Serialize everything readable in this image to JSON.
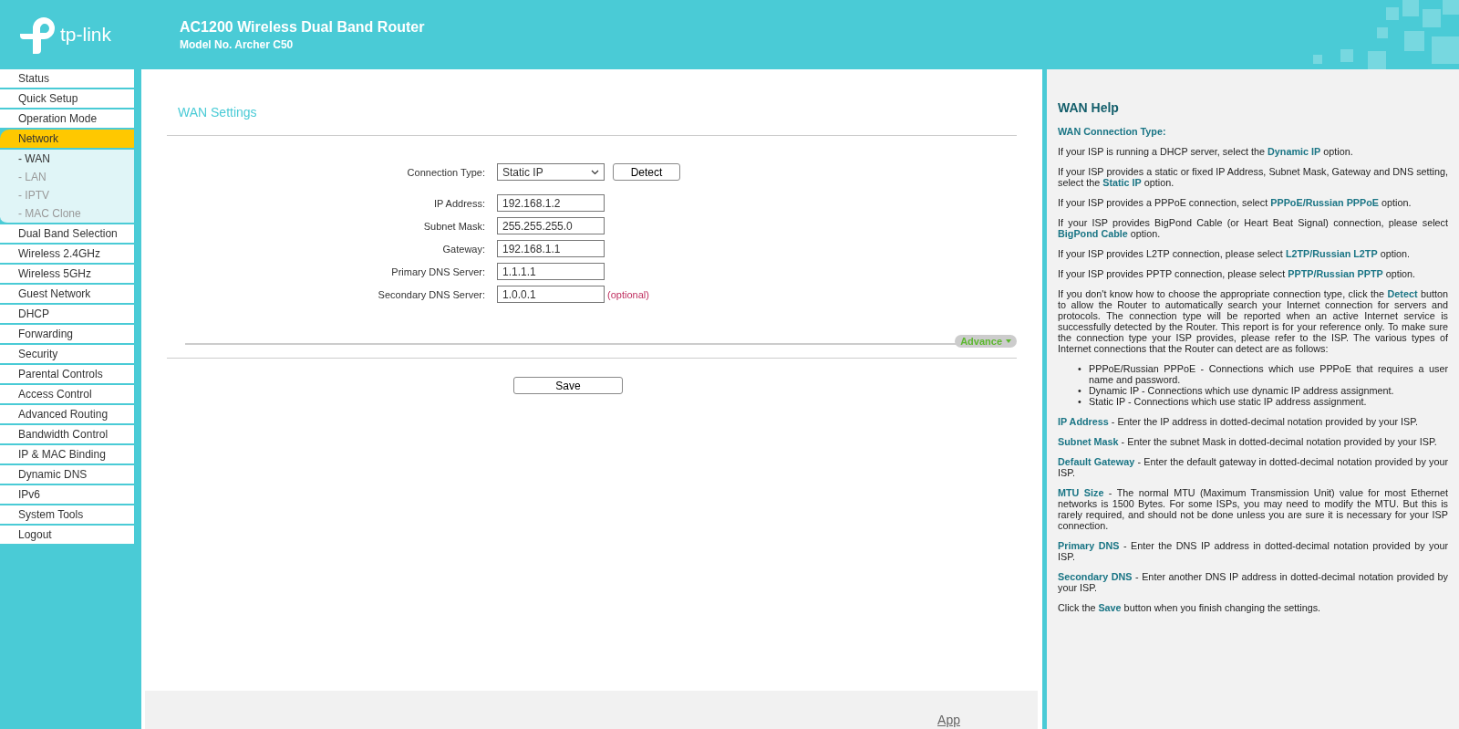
{
  "header": {
    "logo_text": "tp-link",
    "title": "AC1200 Wireless Dual Band Router",
    "model": "Model No. Archer C50"
  },
  "sidebar": {
    "items": [
      {
        "label": "Status",
        "selected": false
      },
      {
        "label": "Quick Setup",
        "selected": false
      },
      {
        "label": "Operation Mode",
        "selected": false
      },
      {
        "label": "Network",
        "selected": true,
        "expanded": true,
        "children": [
          {
            "label": "- WAN",
            "selected": true
          },
          {
            "label": "- LAN",
            "selected": false
          },
          {
            "label": "- IPTV",
            "selected": false
          },
          {
            "label": "- MAC Clone",
            "selected": false
          }
        ]
      },
      {
        "label": "Dual Band Selection",
        "selected": false
      },
      {
        "label": "Wireless 2.4GHz",
        "selected": false
      },
      {
        "label": "Wireless 5GHz",
        "selected": false
      },
      {
        "label": "Guest Network",
        "selected": false
      },
      {
        "label": "DHCP",
        "selected": false
      },
      {
        "label": "Forwarding",
        "selected": false
      },
      {
        "label": "Security",
        "selected": false
      },
      {
        "label": "Parental Controls",
        "selected": false
      },
      {
        "label": "Access Control",
        "selected": false
      },
      {
        "label": "Advanced Routing",
        "selected": false
      },
      {
        "label": "Bandwidth Control",
        "selected": false
      },
      {
        "label": "IP & MAC Binding",
        "selected": false
      },
      {
        "label": "Dynamic DNS",
        "selected": false
      },
      {
        "label": "IPv6",
        "selected": false
      },
      {
        "label": "System Tools",
        "selected": false
      },
      {
        "label": "Logout",
        "selected": false
      }
    ]
  },
  "main": {
    "title": "WAN Settings",
    "fields": [
      {
        "kind": "select",
        "label": "Connection Type:",
        "value": "Static IP",
        "button": "Detect"
      },
      {
        "kind": "input",
        "label": "IP Address:",
        "value": "192.168.1.2"
      },
      {
        "kind": "input",
        "label": "Subnet Mask:",
        "value": "255.255.255.0"
      },
      {
        "kind": "input",
        "label": "Gateway:",
        "value": "192.168.1.1"
      },
      {
        "kind": "input",
        "label": "Primary DNS Server:",
        "value": "1.1.1.1"
      },
      {
        "kind": "input",
        "label": "Secondary DNS Server:",
        "value": "1.0.0.1",
        "note": "(optional)"
      }
    ],
    "advance_button": "Advance",
    "save_button": "Save"
  },
  "help": {
    "title": "WAN Help",
    "subtitle": "WAN Connection Type:",
    "paragraphs_top": [
      "If your ISP is running a DHCP server, select the **Dynamic IP** option.",
      "If your ISP provides a static or fixed IP Address, Subnet Mask, Gateway and DNS setting, select the **Static IP** option.",
      "If your ISP provides a PPPoE connection, select **PPPoE/Russian PPPoE** option.",
      "If your ISP provides BigPond Cable (or Heart Beat Signal) connection, please select **BigPond Cable** option.",
      "If your ISP provides L2TP connection, please select **L2TP/Russian L2TP** option.",
      "If your ISP provides PPTP connection, please select **PPTP/Russian PPTP** option.",
      "If you don't know how to choose the appropriate connection type, click the **Detect** button to allow the Router to automatically search your Internet connection for servers and protocols. The connection type will be reported when an active Internet service is successfully detected by the Router. This report is for your reference only. To make sure the connection type your ISP provides, please refer to the ISP. The various types of Internet connections that the Router can detect are as follows:"
    ],
    "bullets": [
      {
        "marker": "•",
        "text": "PPPoE/Russian PPPoE - Connections which use PPPoE that requires a user name and password."
      },
      {
        "marker": "•",
        "text": "Dynamic IP - Connections which use dynamic IP address assignment."
      },
      {
        "marker": "•",
        "text": "Static IP - Connections which use static IP address assignment."
      }
    ],
    "paragraphs_bottom": [
      "**IP Address** - Enter the IP address in dotted-decimal notation provided by your ISP.",
      "**Subnet Mask** - Enter the subnet Mask in dotted-decimal notation provided by your ISP.",
      "**Default Gateway** - Enter the default gateway in dotted-decimal notation provided by your ISP.",
      "**MTU Size** - The normal MTU (Maximum Transmission Unit) value for most Ethernet networks is 1500 Bytes. For some ISPs, you may need to modify the MTU. But this is rarely required, and should not be done unless you are sure it is necessary for your ISP connection.",
      "**Primary DNS** - Enter the DNS IP address in dotted-decimal notation provided by your ISP.",
      "**Secondary DNS** - Enter another DNS IP address in dotted-decimal notation provided by your ISP.",
      "Click the **Save** button when you finish changing the settings."
    ]
  },
  "footer": {
    "link": "App"
  }
}
